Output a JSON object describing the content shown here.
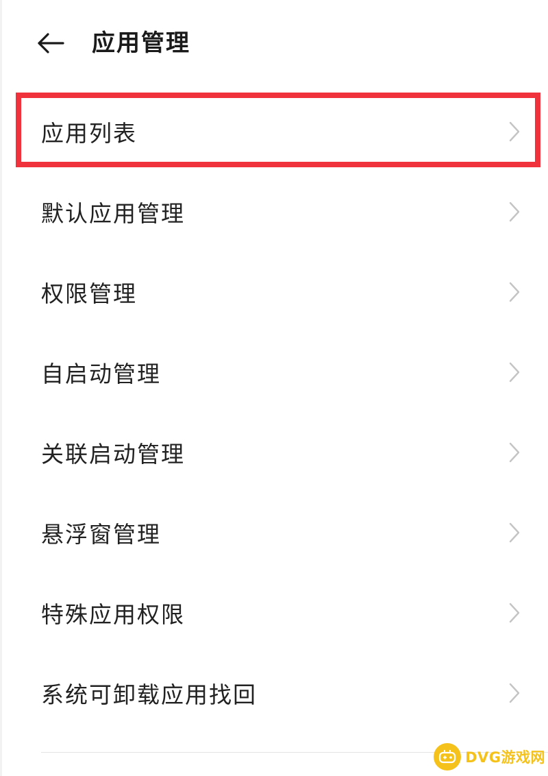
{
  "header": {
    "back_icon": "arrow-left-icon",
    "title": "应用管理"
  },
  "menu": {
    "items": [
      {
        "label": "应用列表",
        "icon": "chevron-right-icon",
        "highlighted": true
      },
      {
        "label": "默认应用管理",
        "icon": "chevron-right-icon"
      },
      {
        "label": "权限管理",
        "icon": "chevron-right-icon"
      },
      {
        "label": "自启动管理",
        "icon": "chevron-right-icon"
      },
      {
        "label": "关联启动管理",
        "icon": "chevron-right-icon"
      },
      {
        "label": "悬浮窗管理",
        "icon": "chevron-right-icon"
      },
      {
        "label": "特殊应用权限",
        "icon": "chevron-right-icon"
      },
      {
        "label": "系统可卸载应用找回",
        "icon": "chevron-right-icon"
      }
    ]
  },
  "colors": {
    "highlight_border": "#f0323c",
    "text": "#222222",
    "chevron": "#c4c4c4",
    "watermark": "#f5c21b"
  },
  "watermark": {
    "text": "DVG游戏网",
    "icon": "gamepad-icon"
  }
}
